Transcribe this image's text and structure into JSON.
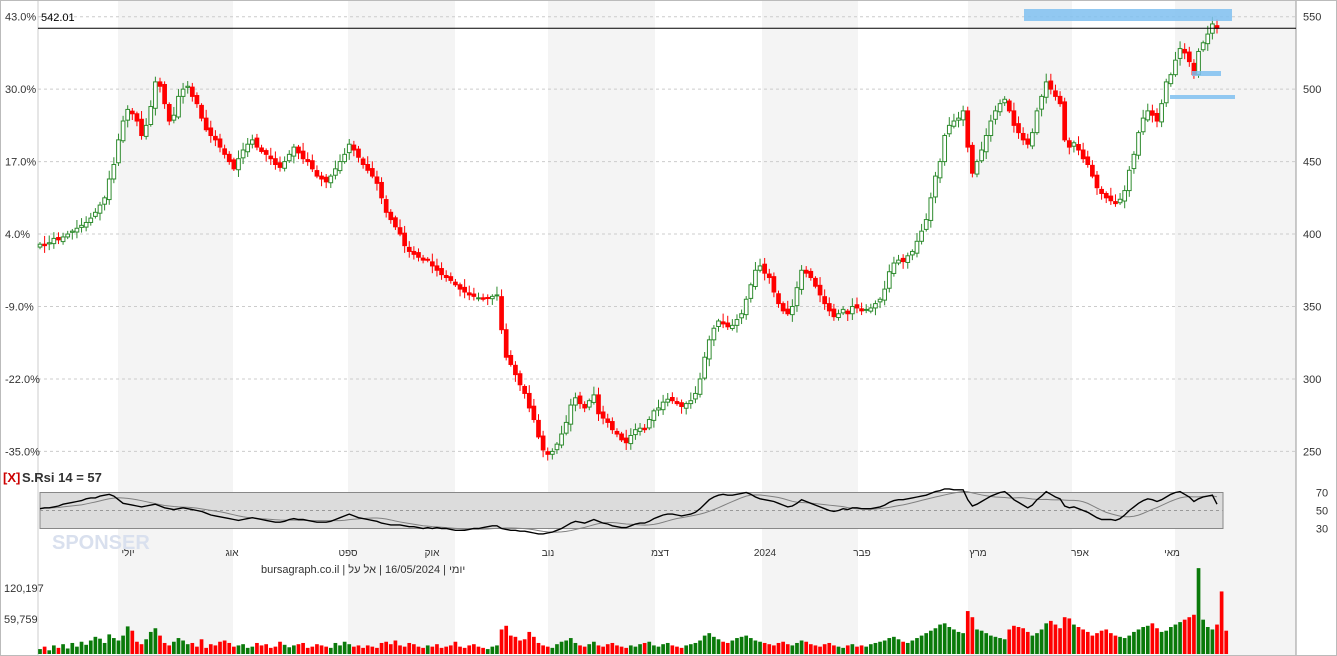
{
  "chart_data": {
    "type": "candlestick",
    "price_axis": {
      "right_ticks": [
        550,
        500,
        450,
        400,
        350,
        300,
        250
      ],
      "left_ticks": [
        "43.0%",
        "30.0%",
        "17.0%",
        "4.0%",
        "-9.0%",
        "-22.0%",
        "-35.0%"
      ],
      "last_price_label": "542.01",
      "ylim": [
        242,
        556
      ]
    },
    "months": [
      "יולי",
      "אוג",
      "ספט",
      "אוק",
      "נוב",
      "דצמ",
      "2024",
      "פבר",
      "מרץ",
      "אפר",
      "מאי"
    ],
    "series": {
      "closes": [
        393,
        392,
        394,
        397,
        396,
        398,
        400,
        402,
        404,
        406,
        408,
        411,
        415,
        420,
        425,
        438,
        448,
        465,
        478,
        486,
        483,
        478,
        468,
        475,
        488,
        505,
        502,
        490,
        478,
        482,
        495,
        500,
        502,
        495,
        490,
        480,
        472,
        468,
        465,
        460,
        455,
        450,
        445,
        452,
        458,
        462,
        465,
        460,
        457,
        455,
        452,
        448,
        446,
        450,
        455,
        460,
        456,
        452,
        450,
        445,
        440,
        438,
        436,
        440,
        445,
        450,
        455,
        462,
        458,
        453,
        448,
        444,
        440,
        435,
        425,
        415,
        410,
        405,
        400,
        392,
        388,
        386,
        384,
        382,
        382,
        378,
        375,
        372,
        370,
        368,
        365,
        362,
        360,
        358,
        357,
        356,
        355,
        356,
        357,
        358,
        334,
        315,
        310,
        303,
        296,
        290,
        280,
        272,
        260,
        251,
        248,
        250,
        255,
        262,
        270,
        282,
        287,
        283,
        280,
        285,
        289,
        276,
        273,
        270,
        265,
        262,
        258,
        256,
        261,
        265,
        266,
        265,
        272,
        278,
        280,
        284,
        286,
        285,
        283,
        281,
        283,
        285,
        290,
        300,
        315,
        327,
        335,
        340,
        338,
        336,
        337,
        341,
        345,
        355,
        365,
        375,
        378,
        373,
        370,
        360,
        352,
        347,
        345,
        350,
        363,
        375,
        373,
        370,
        364,
        358,
        352,
        347,
        343,
        345,
        348,
        345,
        350,
        349,
        347,
        348,
        349,
        352,
        355,
        362,
        374,
        380,
        382,
        381,
        385,
        388,
        395,
        402,
        410,
        425,
        440,
        450,
        468,
        475,
        478,
        480,
        485,
        460,
        442,
        450,
        458,
        468,
        478,
        485,
        490,
        493,
        485,
        475,
        470,
        465,
        462,
        470,
        485,
        495,
        505,
        500,
        495,
        490,
        465,
        460,
        463,
        458,
        452,
        448,
        440,
        432,
        428,
        425,
        423,
        421,
        424,
        430,
        444,
        455,
        470,
        480,
        485,
        482,
        478,
        490,
        505,
        510,
        520,
        528,
        525,
        519,
        510,
        526,
        532,
        538,
        545,
        542.01
      ],
      "rsi": [
        52,
        53,
        53,
        54,
        55,
        57,
        58,
        59,
        60,
        61,
        63,
        64,
        64,
        66,
        67,
        68,
        66,
        62,
        58,
        57,
        56,
        55,
        54,
        55,
        56,
        57,
        55,
        53,
        52,
        51,
        52,
        53,
        52,
        51,
        50,
        49,
        47,
        45,
        44,
        43,
        42,
        41,
        40,
        39,
        40,
        41,
        42,
        41,
        40,
        39,
        38,
        37,
        37,
        38,
        40,
        41,
        40,
        40,
        39,
        38,
        37,
        37,
        37,
        38,
        40,
        42,
        44,
        46,
        44,
        42,
        41,
        40,
        39,
        38,
        36,
        35,
        34,
        34,
        34,
        33,
        32,
        32,
        31,
        30,
        31,
        30,
        31,
        30,
        30,
        29,
        28,
        28,
        28,
        29,
        30,
        30,
        31,
        32,
        33,
        33,
        30,
        29,
        28,
        28,
        27,
        27,
        26,
        25,
        24,
        24,
        25,
        26,
        28,
        30,
        33,
        36,
        38,
        37,
        36,
        38,
        40,
        38,
        36,
        35,
        33,
        32,
        31,
        31,
        33,
        35,
        36,
        36,
        38,
        41,
        43,
        45,
        46,
        46,
        45,
        44,
        45,
        46,
        48,
        52,
        57,
        62,
        65,
        67,
        68,
        67,
        67,
        68,
        69,
        70,
        68,
        65,
        63,
        62,
        61,
        60,
        58,
        56,
        54,
        55,
        58,
        62,
        60,
        58,
        56,
        54,
        52,
        50,
        49,
        50,
        52,
        51,
        53,
        53,
        52,
        52,
        52,
        53,
        54,
        56,
        59,
        61,
        62,
        62,
        63,
        64,
        65,
        66,
        67,
        69,
        71,
        72,
        74,
        74,
        73,
        73,
        73,
        62,
        55,
        57,
        60,
        63,
        66,
        68,
        70,
        71,
        67,
        62,
        59,
        56,
        53,
        56,
        62,
        66,
        71,
        68,
        65,
        63,
        55,
        53,
        54,
        52,
        50,
        48,
        45,
        42,
        40,
        40,
        40,
        39,
        41,
        45,
        50,
        54,
        58,
        61,
        63,
        62,
        60,
        62,
        65,
        68,
        70,
        71,
        68,
        65,
        60,
        63,
        65,
        66,
        67,
        57
      ],
      "volume": [
        8,
        12,
        6,
        14,
        10,
        16,
        9,
        18,
        12,
        20,
        15,
        22,
        28,
        25,
        18,
        32,
        26,
        22,
        30,
        45,
        38,
        20,
        16,
        24,
        36,
        42,
        30,
        18,
        14,
        20,
        26,
        22,
        16,
        18,
        12,
        24,
        10,
        16,
        14,
        20,
        22,
        18,
        12,
        14,
        16,
        10,
        12,
        18,
        14,
        16,
        10,
        12,
        20,
        15,
        11,
        14,
        16,
        18,
        10,
        12,
        16,
        14,
        12,
        10,
        18,
        14,
        20,
        16,
        12,
        14,
        10,
        14,
        12,
        10,
        18,
        20,
        16,
        22,
        14,
        12,
        18,
        16,
        12,
        10,
        14,
        12,
        16,
        10,
        12,
        14,
        20,
        12,
        10,
        14,
        16,
        12,
        10,
        8,
        12,
        14,
        40,
        46,
        30,
        28,
        22,
        24,
        36,
        28,
        18,
        14,
        12,
        10,
        16,
        20,
        22,
        26,
        18,
        14,
        12,
        16,
        20,
        14,
        12,
        16,
        18,
        14,
        12,
        10,
        14,
        12,
        16,
        18,
        20,
        14,
        12,
        16,
        18,
        14,
        12,
        10,
        14,
        16,
        18,
        22,
        30,
        34,
        28,
        24,
        20,
        18,
        22,
        26,
        28,
        30,
        26,
        22,
        20,
        18,
        16,
        14,
        18,
        20,
        16,
        14,
        18,
        22,
        20,
        16,
        14,
        12,
        16,
        18,
        14,
        12,
        10,
        14,
        16,
        12,
        14,
        12,
        16,
        18,
        20,
        22,
        26,
        28,
        24,
        20,
        18,
        22,
        26,
        30,
        34,
        38,
        42,
        48,
        50,
        44,
        40,
        36,
        34,
        70,
        60,
        40,
        38,
        34,
        30,
        28,
        26,
        24,
        40,
        46,
        44,
        42,
        36,
        30,
        34,
        40,
        50,
        54,
        48,
        42,
        60,
        58,
        48,
        44,
        40,
        36,
        30,
        34,
        38,
        40,
        34,
        30,
        28,
        26,
        30,
        36,
        40,
        44,
        46,
        50,
        42,
        36,
        38,
        44,
        48,
        52,
        56,
        60,
        64,
        140,
        56,
        44,
        40,
        48,
        102,
        38
      ]
    },
    "rsi_panel": {
      "label": "S.Rsi 14 = 57",
      "close_marker": "[X]",
      "ticks": [
        70,
        50,
        30
      ]
    },
    "volume_panel": {
      "ticks": [
        "120,197",
        "59,759"
      ]
    },
    "footer_text": "יומי | 16/05/2024 | אל על | bursagraph.co.il",
    "watermark": "SPONSER",
    "colors": {
      "up": "#2e8b2e",
      "down": "#ff0000",
      "highlight": "#7fbff0",
      "volume_up": "#0a7a0a",
      "volume_down": "#ff0000",
      "rsi_line": "#000000",
      "rsi_avg": "#808080"
    }
  }
}
